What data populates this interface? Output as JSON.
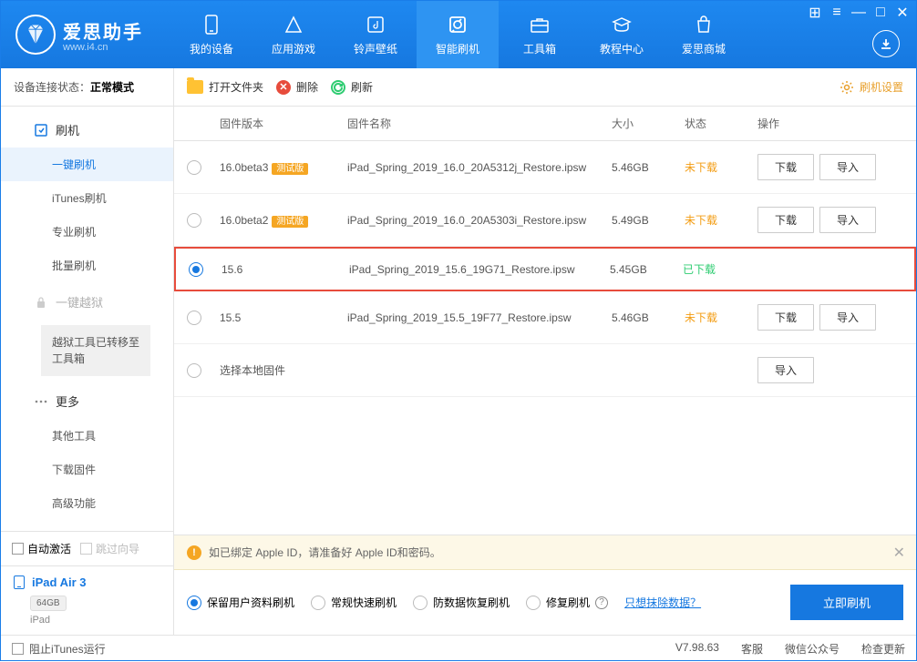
{
  "header": {
    "app_name": "爱思助手",
    "url": "www.i4.cn",
    "tabs": [
      {
        "label": "我的设备"
      },
      {
        "label": "应用游戏"
      },
      {
        "label": "铃声壁纸"
      },
      {
        "label": "智能刷机"
      },
      {
        "label": "工具箱"
      },
      {
        "label": "教程中心"
      },
      {
        "label": "爱思商城"
      }
    ]
  },
  "sidebar": {
    "status_label": "设备连接状态：",
    "status_value": "正常模式",
    "flash_header": "刷机",
    "items_flash": [
      "一键刷机",
      "iTunes刷机",
      "专业刷机",
      "批量刷机"
    ],
    "jailbreak_header": "一键越狱",
    "jailbreak_tip": "越狱工具已转移至工具箱",
    "more_header": "更多",
    "items_more": [
      "其他工具",
      "下载固件",
      "高级功能"
    ],
    "auto_activate": "自动激活",
    "skip_guide": "跳过向导",
    "device_name": "iPad Air 3",
    "device_storage": "64GB",
    "device_type": "iPad"
  },
  "toolbar": {
    "open_folder": "打开文件夹",
    "delete": "删除",
    "refresh": "刷新",
    "settings": "刷机设置"
  },
  "table": {
    "headers": {
      "version": "固件版本",
      "name": "固件名称",
      "size": "大小",
      "status": "状态",
      "action": "操作"
    },
    "rows": [
      {
        "version": "16.0beta3",
        "beta": "测试版",
        "name": "iPad_Spring_2019_16.0_20A5312j_Restore.ipsw",
        "size": "5.46GB",
        "status": "未下载",
        "status_color": "orange",
        "selected": false,
        "actions": [
          "下载",
          "导入"
        ]
      },
      {
        "version": "16.0beta2",
        "beta": "测试版",
        "name": "iPad_Spring_2019_16.0_20A5303i_Restore.ipsw",
        "size": "5.49GB",
        "status": "未下载",
        "status_color": "orange",
        "selected": false,
        "actions": [
          "下载",
          "导入"
        ]
      },
      {
        "version": "15.6",
        "beta": "",
        "name": "iPad_Spring_2019_15.6_19G71_Restore.ipsw",
        "size": "5.45GB",
        "status": "已下载",
        "status_color": "green",
        "selected": true,
        "actions": []
      },
      {
        "version": "15.5",
        "beta": "",
        "name": "iPad_Spring_2019_15.5_19F77_Restore.ipsw",
        "size": "5.46GB",
        "status": "未下载",
        "status_color": "orange",
        "selected": false,
        "actions": [
          "下载",
          "导入"
        ]
      },
      {
        "version": "",
        "beta": "",
        "name": "选择本地固件",
        "size": "",
        "status": "",
        "status_color": "",
        "selected": false,
        "actions": [
          "导入"
        ]
      }
    ]
  },
  "notice": "如已绑定 Apple ID，请准备好 Apple ID和密码。",
  "options": {
    "opt1": "保留用户资料刷机",
    "opt2": "常规快速刷机",
    "opt3": "防数据恢复刷机",
    "opt4": "修复刷机",
    "erase_link": "只想抹除数据？",
    "flash_btn": "立即刷机"
  },
  "statusbar": {
    "block_itunes": "阻止iTunes运行",
    "version": "V7.98.63",
    "customer": "客服",
    "wechat": "微信公众号",
    "update": "检查更新"
  }
}
